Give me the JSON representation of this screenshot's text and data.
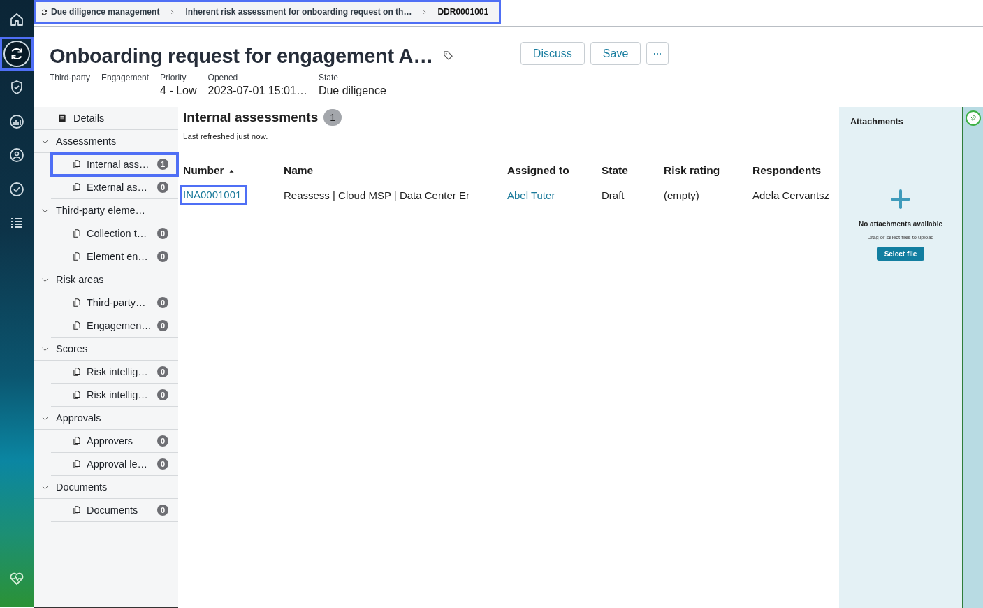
{
  "nav": {
    "items": [
      {
        "selected": false,
        "focused": false
      },
      {
        "selected": true,
        "focused": true
      },
      {
        "selected": false,
        "focused": false
      },
      {
        "selected": false,
        "focused": false
      },
      {
        "selected": false,
        "focused": false
      },
      {
        "selected": false,
        "focused": false
      },
      {
        "selected": false,
        "focused": false
      }
    ],
    "bottom": [
      {
        "selected": false,
        "focused": false
      }
    ]
  },
  "breadcrumbs": {
    "focused": true,
    "items": [
      "Due diligence management",
      "Inherent risk assessment for onboarding request on th…",
      "DDR0001001"
    ]
  },
  "record": {
    "title": "Onboarding request for engagement A…",
    "buttons": [
      {
        "label": "Discuss",
        "kind": "text"
      },
      {
        "label": "Save",
        "kind": "text"
      },
      {
        "label": "···",
        "kind": "more"
      }
    ],
    "fields": [
      {
        "label": "Third-party"
      },
      {
        "label": "Engagement"
      },
      {
        "label": "Priority",
        "value": "4 - Low"
      },
      {
        "label": "Opened",
        "value": "2023-07-01 15:01…"
      },
      {
        "label": "State",
        "value": "Due diligence"
      }
    ]
  },
  "sidebar": {
    "items": [
      {
        "kind": "link",
        "label": "Details"
      },
      {
        "kind": "group",
        "label": "Assessments",
        "expanded": true,
        "children": [
          {
            "label": "Internal ass…",
            "count": "1",
            "focused": true
          },
          {
            "label": "External as…",
            "count": "0",
            "focused": false
          }
        ]
      },
      {
        "kind": "group",
        "label": "Third-party eleme…",
        "expanded": true,
        "children": [
          {
            "label": "Collection t…",
            "count": "0",
            "focused": false
          },
          {
            "label": "Element en…",
            "count": "0",
            "focused": false
          }
        ]
      },
      {
        "kind": "group",
        "label": "Risk areas",
        "expanded": true,
        "children": [
          {
            "label": "Third-party…",
            "count": "0",
            "focused": false
          },
          {
            "label": "Engagemen…",
            "count": "0",
            "focused": false
          }
        ]
      },
      {
        "kind": "group",
        "label": "Scores",
        "expanded": true,
        "children": [
          {
            "label": "Risk intellig…",
            "count": "0",
            "focused": false
          },
          {
            "label": "Risk intellig…",
            "count": "0",
            "focused": false
          }
        ]
      },
      {
        "kind": "group",
        "label": "Approvals",
        "expanded": true,
        "children": [
          {
            "label": "Approvers",
            "count": "0",
            "focused": false
          },
          {
            "label": "Approval le…",
            "count": "0",
            "focused": false
          }
        ]
      },
      {
        "kind": "group",
        "label": "Documents",
        "expanded": true,
        "children": [
          {
            "label": "Documents",
            "count": "0",
            "focused": false
          }
        ]
      }
    ]
  },
  "list": {
    "title": "Internal assessments",
    "count": "1",
    "subtitle": "Last refreshed just now.",
    "columns": [
      {
        "label": "Number",
        "sorted": true
      },
      {
        "label": "Name",
        "sorted": false
      },
      {
        "label": "Assigned to",
        "sorted": false
      },
      {
        "label": "State",
        "sorted": false
      },
      {
        "label": "Risk rating",
        "sorted": false
      },
      {
        "label": "Respondents",
        "sorted": false
      }
    ],
    "rows": [
      {
        "cells": [
          {
            "text": "INA0001001",
            "kind": "link",
            "focused": true
          },
          {
            "text": "Reassess | Cloud MSP | Data Center Er",
            "kind": "text",
            "focused": false
          },
          {
            "text": "Abel Tuter",
            "kind": "link",
            "focused": false
          },
          {
            "text": "Draft",
            "kind": "text",
            "focused": false
          },
          {
            "text": "(empty)",
            "kind": "text",
            "focused": false
          },
          {
            "text": "Adela Cervantsz",
            "kind": "text",
            "focused": false
          }
        ]
      }
    ]
  },
  "attachments": {
    "title": "Attachments",
    "empty_message": "No attachments available",
    "hint": "Drag or select files to upload",
    "button": "Select file"
  }
}
